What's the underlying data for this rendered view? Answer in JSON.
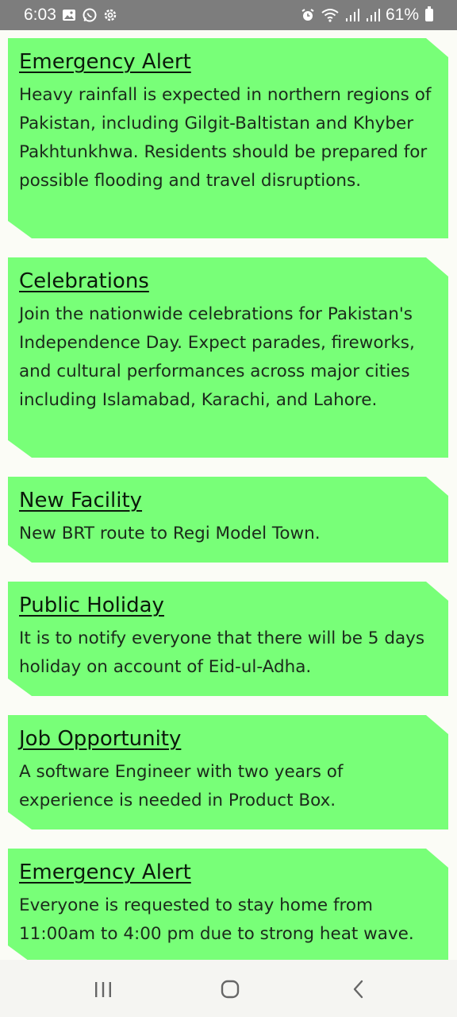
{
  "status_bar": {
    "time": "6:03",
    "battery": "61%",
    "left_icons": [
      "gallery-icon",
      "whatsapp-icon",
      "settings-icon"
    ],
    "right_icons": [
      "alarm-icon",
      "wifi-icon",
      "signal-icon",
      "signal-icon",
      "battery-icon"
    ]
  },
  "cards": [
    {
      "title": "Emergency Alert",
      "body": "Heavy rainfall is expected in northern regions of Pakistan, including Gilgit-Baltistan and Khyber Pakhtunkhwa. Residents should be prepared for possible flooding and travel disruptions."
    },
    {
      "title": "Celebrations",
      "body": "Join the nationwide celebrations for Pakistan's Independence Day. Expect parades, fireworks, and cultural performances across major cities including Islamabad, Karachi, and Lahore."
    },
    {
      "title": "New Facility",
      "body": "New BRT route to Regi Model Town."
    },
    {
      "title": "Public Holiday",
      "body": "It is to notify everyone that there will be 5 days holiday on account of Eid-ul-Adha."
    },
    {
      "title": "Job Opportunity",
      "body": "A software Engineer with two years of experience is needed in Product Box."
    },
    {
      "title": "Emergency Alert",
      "body": "Everyone is requested to stay home from 11:00am to 4:00 pm due to strong heat wave."
    }
  ],
  "nav_bar": {
    "buttons": [
      "recent-apps-icon",
      "home-icon",
      "back-icon"
    ]
  },
  "colors": {
    "card_bg": "#78ff78",
    "status_bar_bg": "#7d7d7d",
    "page_bg": "#fbfcf6",
    "nav_bg": "#f5f5f2"
  }
}
